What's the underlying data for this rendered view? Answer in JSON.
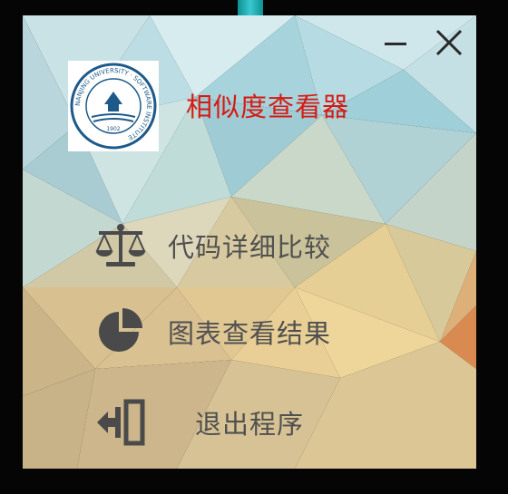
{
  "window": {
    "title": "相似度查看器",
    "controls": {
      "minimize": "minimize-icon",
      "close": "close-icon"
    }
  },
  "logo": {
    "ring_text": "NANJING UNIVERSITY · SOFTWARE INSTITUTE",
    "year": "1902"
  },
  "menu": [
    {
      "label": "代码详细比较",
      "icon": "scale-icon"
    },
    {
      "label": "图表查看结果",
      "icon": "pie-chart-icon"
    },
    {
      "label": "退出程序",
      "icon": "exit-door-icon"
    }
  ],
  "colors": {
    "title": "#d61a12",
    "menu_text": "#505050",
    "icon": "#4a4a4a"
  }
}
